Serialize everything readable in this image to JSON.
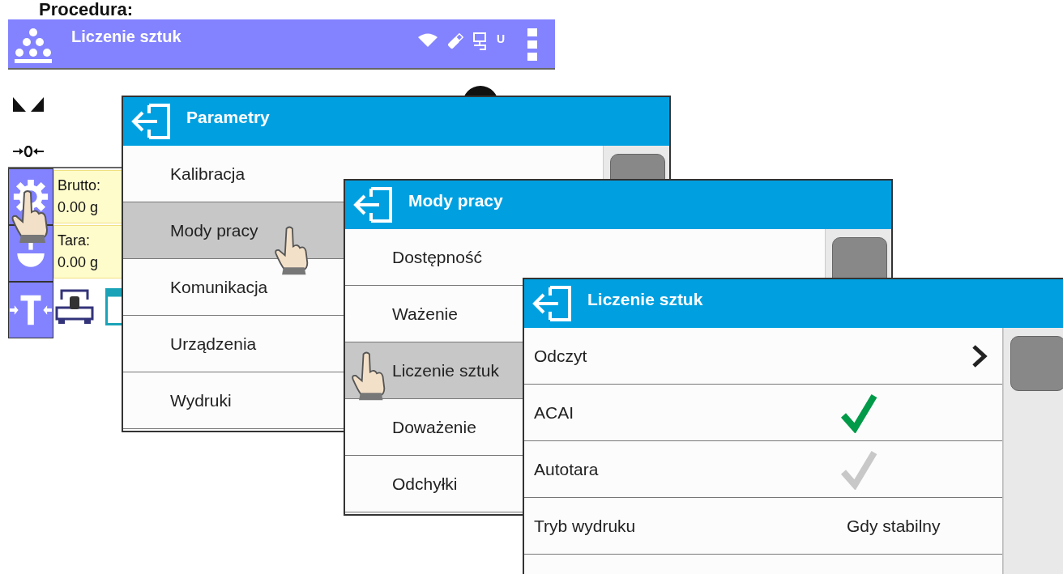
{
  "heading": "Procedura:",
  "home": {
    "title": "Liczenie sztuk",
    "status_glyph": "U",
    "settings_pressed": true,
    "brutto_label": "Brutto:",
    "brutto_value": "0.00 g",
    "tara_label": "Tara:",
    "tara_value": "0.00 g"
  },
  "windows": [
    {
      "title": "Parametry",
      "items": [
        {
          "label": "Kalibracja",
          "selected": false
        },
        {
          "label": "Mody pracy",
          "selected": true
        },
        {
          "label": "Komunikacja",
          "selected": false
        },
        {
          "label": "Urządzenia",
          "selected": false
        },
        {
          "label": "Wydruki",
          "selected": false
        }
      ]
    },
    {
      "title": "Mody pracy",
      "items": [
        {
          "label": "Dostępność",
          "selected": false
        },
        {
          "label": "Ważenie",
          "selected": false
        },
        {
          "label": "Liczenie sztuk",
          "selected": true
        },
        {
          "label": "Doważenie",
          "selected": false
        },
        {
          "label": "Odchyłki",
          "selected": false
        }
      ]
    },
    {
      "title": "Liczenie sztuk",
      "items": [
        {
          "label": "Odczyt",
          "kind": "submenu"
        },
        {
          "label": "ACAI",
          "kind": "check",
          "checked": true
        },
        {
          "label": "Autotara",
          "kind": "check",
          "checked": false
        },
        {
          "label": "Tryb wydruku",
          "kind": "value",
          "value": "Gdy stabilny"
        }
      ]
    }
  ]
}
